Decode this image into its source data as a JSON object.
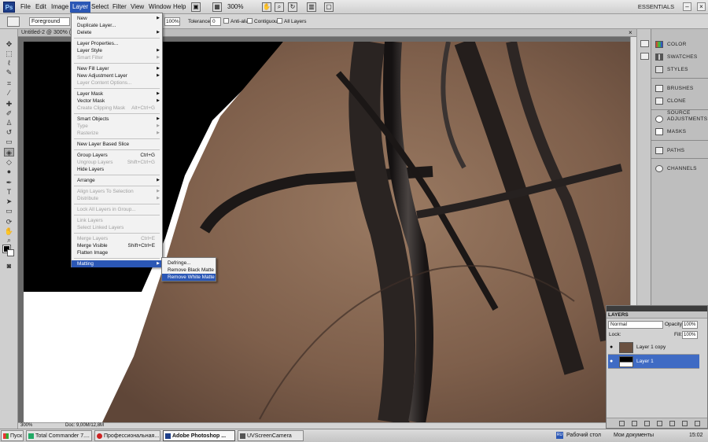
{
  "menubar": {
    "logo": "Ps",
    "items": [
      "File",
      "Edit",
      "Image",
      "Layer",
      "Select",
      "Filter",
      "View",
      "Window",
      "Help"
    ],
    "active": "Layer",
    "zoom": "300%",
    "workspace": "ESSENTIALS"
  },
  "options": {
    "fill_source": "Foreground",
    "opacity": "100%",
    "tolerance_label": "Tolerance:",
    "tolerance": "0",
    "anti_alias": "Anti-alias",
    "contiguous": "Contiguous",
    "all_layers": "All Layers"
  },
  "document": {
    "title": "Untitled-2 @ 300% (",
    "status_zoom": "300%",
    "status_doc": "Doc: 9,00M/12,8M"
  },
  "layer_menu": {
    "items": [
      {
        "label": "New",
        "submenu": true
      },
      {
        "label": "Duplicate Layer..."
      },
      {
        "label": "Delete",
        "submenu": true
      },
      {
        "sep": true
      },
      {
        "label": "Layer Properties..."
      },
      {
        "label": "Layer Style",
        "submenu": true
      },
      {
        "label": "Smart Filter",
        "disabled": true,
        "submenu": true
      },
      {
        "sep": true
      },
      {
        "label": "New Fill Layer",
        "submenu": true
      },
      {
        "label": "New Adjustment Layer",
        "submenu": true
      },
      {
        "label": "Layer Content Options...",
        "disabled": true
      },
      {
        "sep": true
      },
      {
        "label": "Layer Mask",
        "submenu": true
      },
      {
        "label": "Vector Mask",
        "submenu": true
      },
      {
        "label": "Create Clipping Mask",
        "shortcut": "Alt+Ctrl+G",
        "disabled": true
      },
      {
        "sep": true
      },
      {
        "label": "Smart Objects",
        "submenu": true
      },
      {
        "label": "Type",
        "disabled": true,
        "submenu": true
      },
      {
        "label": "Rasterize",
        "disabled": true,
        "submenu": true
      },
      {
        "sep": true
      },
      {
        "label": "New Layer Based Slice"
      },
      {
        "sep": true
      },
      {
        "label": "Group Layers",
        "shortcut": "Ctrl+G"
      },
      {
        "label": "Ungroup Layers",
        "shortcut": "Shift+Ctrl+G",
        "disabled": true
      },
      {
        "label": "Hide Layers"
      },
      {
        "sep": true
      },
      {
        "label": "Arrange",
        "submenu": true
      },
      {
        "sep": true
      },
      {
        "label": "Align Layers To Selection",
        "disabled": true,
        "submenu": true
      },
      {
        "label": "Distribute",
        "disabled": true,
        "submenu": true
      },
      {
        "sep": true
      },
      {
        "label": "Lock All Layers in Group...",
        "disabled": true
      },
      {
        "sep": true
      },
      {
        "label": "Link Layers",
        "disabled": true
      },
      {
        "label": "Select Linked Layers",
        "disabled": true
      },
      {
        "sep": true
      },
      {
        "label": "Merge Layers",
        "shortcut": "Ctrl+E",
        "disabled": true
      },
      {
        "label": "Merge Visible",
        "shortcut": "Shift+Ctrl+E"
      },
      {
        "label": "Flatten Image"
      },
      {
        "sep": true
      },
      {
        "label": "Matting",
        "submenu": true,
        "highlight": true
      }
    ]
  },
  "matting_menu": {
    "items": [
      {
        "label": "Defringe..."
      },
      {
        "label": "Remove Black Matte"
      },
      {
        "label": "Remove White Matte",
        "highlight": true
      }
    ]
  },
  "panels": [
    {
      "label": "COLOR",
      "icon": "color-icon"
    },
    {
      "label": "SWATCHES",
      "icon": "swatches-icon"
    },
    {
      "label": "STYLES",
      "icon": "styles-icon"
    },
    {
      "label": "BRUSHES",
      "icon": "brushes-icon"
    },
    {
      "label": "CLONE SOURCE",
      "icon": "clone-source-icon"
    },
    {
      "label": "ADJUSTMENTS",
      "icon": "adjustments-icon"
    },
    {
      "label": "MASKS",
      "icon": "masks-icon"
    },
    {
      "label": "PATHS",
      "icon": "paths-icon"
    },
    {
      "label": "CHANNELS",
      "icon": "channels-icon"
    }
  ],
  "layers_panel": {
    "title": "LAYERS",
    "blend_mode": "Normal",
    "opacity_label": "Opacity:",
    "opacity": "100%",
    "lock_label": "Lock:",
    "fill_label": "Fill:",
    "fill": "100%",
    "layers": [
      {
        "name": "Layer 1 copy",
        "selected": false
      },
      {
        "name": "Layer 1",
        "selected": true
      }
    ]
  },
  "taskbar": {
    "start": "Пуск",
    "tasks": [
      {
        "label": "Total Commander 7....",
        "active": false
      },
      {
        "label": "Профессиональная...",
        "active": false
      },
      {
        "label": "Adobe Photoshop ...",
        "active": true
      },
      {
        "label": "UVScreenCamera",
        "active": false
      }
    ],
    "lang": "RU",
    "desktop": "Рабочий стол",
    "docs": "Мои документы",
    "time": "15:02"
  },
  "colors": {
    "highlight": "#2b57b5",
    "skin": "#8a6a55",
    "hair": "#1f1b1a",
    "foreground": "#000000",
    "background": "#ffffff"
  }
}
